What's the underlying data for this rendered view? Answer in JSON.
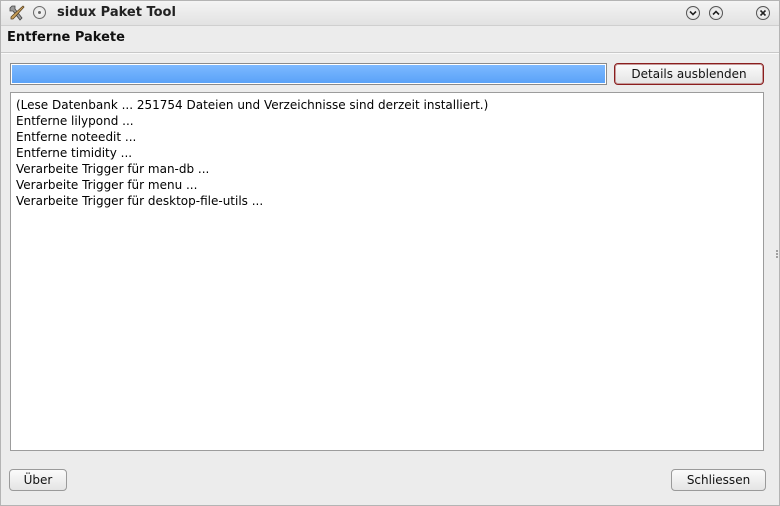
{
  "window": {
    "title": "sidux Paket Tool"
  },
  "page": {
    "heading": "Entferne Pakete"
  },
  "progress": {
    "value_percent": 100
  },
  "buttons": {
    "details": "Details ausblenden",
    "about": "Über",
    "close": "Schliessen"
  },
  "log": {
    "lines": [
      "(Lese Datenbank ... 251754 Dateien und Verzeichnisse sind derzeit installiert.)",
      "Entferne lilypond ...",
      "Entferne noteedit ...",
      "Entferne timidity ...",
      "Verarbeite Trigger für man-db ...",
      "Verarbeite Trigger für menu ...",
      "Verarbeite Trigger für desktop-file-utils ..."
    ]
  },
  "icons": {
    "app": "tools-icon",
    "window_menu": "window-menu-icon",
    "minimize": "minimize-icon",
    "maximize": "maximize-icon",
    "close": "close-icon"
  },
  "colors": {
    "progress_fill": "#5aa2f8",
    "focus_border": "#8a1e1e"
  }
}
